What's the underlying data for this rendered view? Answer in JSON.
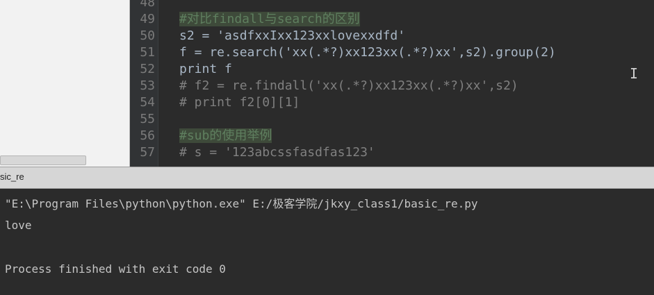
{
  "editor": {
    "lines": [
      {
        "num": "48",
        "code": ""
      },
      {
        "num": "49",
        "code": "#对比findall与search的区别"
      },
      {
        "num": "50",
        "code": "s2 = 'asdfxxIxx123xxlovexxdfd'"
      },
      {
        "num": "51",
        "code": "f = re.search('xx(.*?)xx123xx(.*?)xx',s2).group(2)"
      },
      {
        "num": "52",
        "code": "print f"
      },
      {
        "num": "53",
        "code": "# f2 = re.findall('xx(.*?)xx123xx(.*?)xx',s2)"
      },
      {
        "num": "54",
        "code": "# print f2[0][1]"
      },
      {
        "num": "55",
        "code": ""
      },
      {
        "num": "56",
        "code": "#sub的使用举例"
      },
      {
        "num": "57",
        "code": "# s = '123abcssfasdfas123'"
      }
    ]
  },
  "run_tab": {
    "label": "sic_re"
  },
  "console": {
    "command": "\"E:\\Program Files\\python\\python.exe\" E:/极客学院/jkxy_class1/basic_re.py",
    "output": "love",
    "finished": "Process finished with exit code 0"
  },
  "colors": {
    "keyword": "#cc7832",
    "string": "#6a8759",
    "comment": "#808080",
    "number": "#6897bb",
    "background": "#2b2b2b"
  }
}
